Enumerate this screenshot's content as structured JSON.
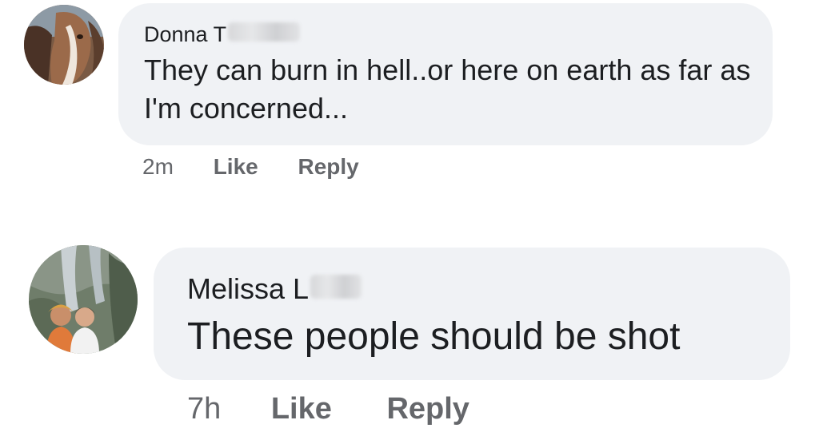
{
  "comments": [
    {
      "author": "Donna T",
      "avatar_icon": "horse-avatar-icon",
      "text": "They can burn in hell..or here on earth as far as I'm concerned...",
      "time": "2m",
      "like_label": "Like",
      "reply_label": "Reply"
    },
    {
      "author": "Melissa L",
      "avatar_icon": "people-waterfall-avatar-icon",
      "text": "These people should be shot",
      "time": "7h",
      "like_label": "Like",
      "reply_label": "Reply"
    }
  ],
  "colors": {
    "bubble": "#f0f2f5",
    "text": "#1c1e21",
    "secondary": "#65676b"
  }
}
